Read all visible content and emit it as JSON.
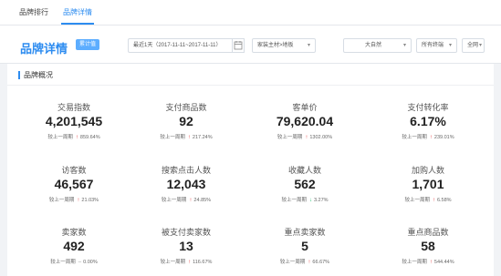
{
  "nav": {
    "tabs": [
      "品牌排行",
      "品牌详情"
    ],
    "active": 1
  },
  "header": {
    "title": "品牌详情",
    "badge": "累计值",
    "date_range": "最近1天（2017-11-11~2017-11-11）",
    "category": "家装主材>地板",
    "brand": "大自然",
    "terminal": "所有终端",
    "channel": "全网"
  },
  "section": {
    "title": "品牌概况"
  },
  "compare_label": "较上一周期",
  "colors": {
    "accent": "#2d8cf0",
    "up": "#e4393c",
    "down": "#19be6b"
  },
  "metrics": [
    {
      "name": "交易指数",
      "value": "4,201,545",
      "dir": "up",
      "change": "859.64%"
    },
    {
      "name": "支付商品数",
      "value": "92",
      "dir": "up",
      "change": "217.24%"
    },
    {
      "name": "客单价",
      "value": "79,620.04",
      "dir": "up",
      "change": "1302.00%"
    },
    {
      "name": "支付转化率",
      "value": "6.17%",
      "dir": "up",
      "change": "239.01%"
    },
    {
      "name": "访客数",
      "value": "46,567",
      "dir": "up",
      "change": "21.03%"
    },
    {
      "name": "搜索点击人数",
      "value": "12,043",
      "dir": "up",
      "change": "24.85%"
    },
    {
      "name": "收藏人数",
      "value": "562",
      "dir": "down",
      "change": "3.27%"
    },
    {
      "name": "加购人数",
      "value": "1,701",
      "dir": "up",
      "change": "6.58%"
    },
    {
      "name": "卖家数",
      "value": "492",
      "dir": "flat",
      "change": "0.00%"
    },
    {
      "name": "被支付卖家数",
      "value": "13",
      "dir": "up",
      "change": "116.67%"
    },
    {
      "name": "重点卖家数",
      "value": "5",
      "dir": "up",
      "change": "66.67%"
    },
    {
      "name": "重点商品数",
      "value": "58",
      "dir": "up",
      "change": "544.44%"
    }
  ]
}
